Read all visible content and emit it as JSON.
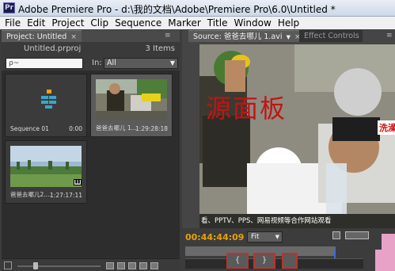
{
  "window": {
    "app_icon": "Pr",
    "title": "Adobe Premiere Pro - d:\\我的文档\\Adobe\\Premiere Pro\\6.0\\Untitled *"
  },
  "menu": [
    "File",
    "Edit",
    "Project",
    "Clip",
    "Sequence",
    "Marker",
    "Title",
    "Window",
    "Help"
  ],
  "project_panel": {
    "tab_label": "Project: Untitled",
    "close": "×",
    "file_name": "Untitled.prproj",
    "item_count": "3 Items",
    "search_placeholder": "ρ~",
    "in_label": "In:",
    "in_value": "All",
    "items": [
      {
        "label": "Sequence 01",
        "duration": "0:00",
        "icon": "sequence-icon"
      },
      {
        "label": "爸爸去哪儿 1...",
        "duration": "1:29:28:18",
        "icon": "video-clip-thumbnail"
      },
      {
        "label": "爸爸去哪儿2....",
        "duration": "1:27:17:11",
        "icon": "video-clip-thumbnail"
      }
    ]
  },
  "source_panel": {
    "tab_label": "Source: 爸爸去哪儿 1.avi",
    "tab_arrow": "▼",
    "close": "×",
    "effect_controls_label": "Effect Controls",
    "overlay_text": "源面板",
    "overlay_badge": "洗澡",
    "subtitle": "看、PPTV、PPS、网易视频等合作网站观看",
    "timecode": "00:44:44:09",
    "fit_label": "Fit",
    "mark_in_label": "{",
    "mark_out_label": "}",
    "colors": {
      "timecode": "#e8a200",
      "highlight_border": "#c0312b",
      "overlay_text": "#c31313"
    }
  }
}
